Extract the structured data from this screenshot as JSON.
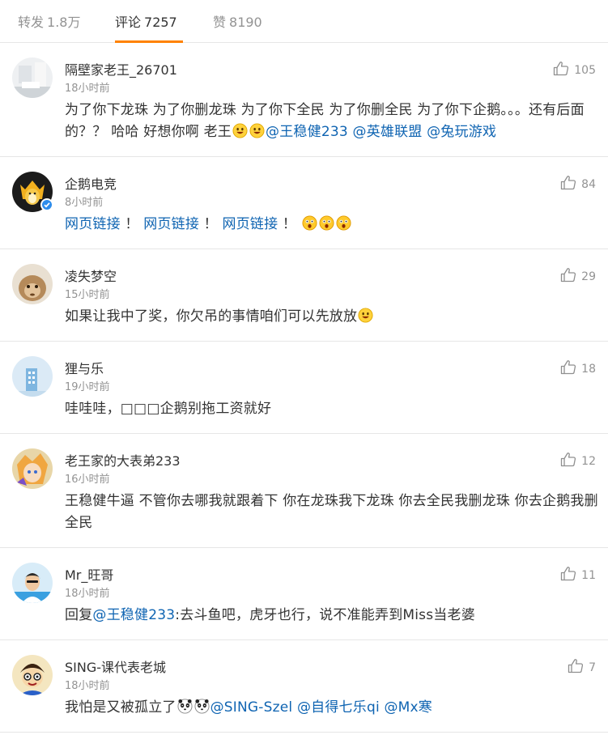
{
  "tabs": [
    {
      "label": "转发",
      "count": "1.8万"
    },
    {
      "label": "评论",
      "count": "7257"
    },
    {
      "label": "赞",
      "count": "8190"
    }
  ],
  "colors": {
    "accent": "#ff8200",
    "link": "#0f64b2",
    "meta": "#939393"
  },
  "comments": [
    {
      "user": "隔壁家老王_26701",
      "time": "18小时前",
      "likes": "105",
      "avatar_icon": "white-room-avatar",
      "text1": "为了你下龙珠 为了你删龙珠 为了你下全民 为了你删全民 为了你下企鹅。。。还有后面的？？ 哈哈 好想你啊 老王",
      "emojis": [
        "grin-emoji",
        "grin-emoji"
      ],
      "mentions": [
        "@王稳健233",
        "@英雄联盟",
        "@兔玩游戏"
      ]
    },
    {
      "user": "企鹅电竞",
      "time": "8小时前",
      "likes": "84",
      "avatar_icon": "penguin-crown-avatar",
      "verified_icon": "verified-badge-icon",
      "links": [
        "网页链接",
        "网页链接",
        "网页链接"
      ],
      "separator": "！",
      "emojis": [
        "shock-emoji",
        "shock-emoji",
        "shock-emoji"
      ]
    },
    {
      "user": "凌失梦空",
      "time": "15小时前",
      "likes": "29",
      "avatar_icon": "monkey-avatar",
      "text1": "如果让我中了奖，你欠吊的事情咱们可以先放放",
      "emojis": [
        "grin-emoji"
      ]
    },
    {
      "user": "狸与乐",
      "time": "19小时前",
      "likes": "18",
      "avatar_icon": "building-avatar",
      "text1": "哇哇哇，□□□企鹅别拖工资就好"
    },
    {
      "user": "老王家的大表弟233",
      "time": "16小时前",
      "likes": "12",
      "avatar_icon": "anime-avatar",
      "text1": "王稳健牛逼 不管你去哪我就跟着下 你在龙珠我下龙珠 你去全民我删龙珠 你去企鹅我删全民"
    },
    {
      "user": "Mr_旺哥",
      "time": "18小时前",
      "likes": "11",
      "avatar_icon": "man-avatar",
      "prefix": "回复",
      "mention": "@王稳健233",
      "text1": ":去斗鱼吧，虎牙也行，说不准能弄到Miss当老婆"
    },
    {
      "user": "SING-课代表老城",
      "time": "18小时前",
      "likes": "7",
      "avatar_icon": "cartoon-boy-avatar",
      "text1": "我怕是又被孤立了",
      "emojis": [
        "panda-emoji",
        "panda-emoji"
      ],
      "mentions": [
        "@SING-Szel",
        "@自得七乐qi",
        "@Mx寒"
      ]
    }
  ]
}
